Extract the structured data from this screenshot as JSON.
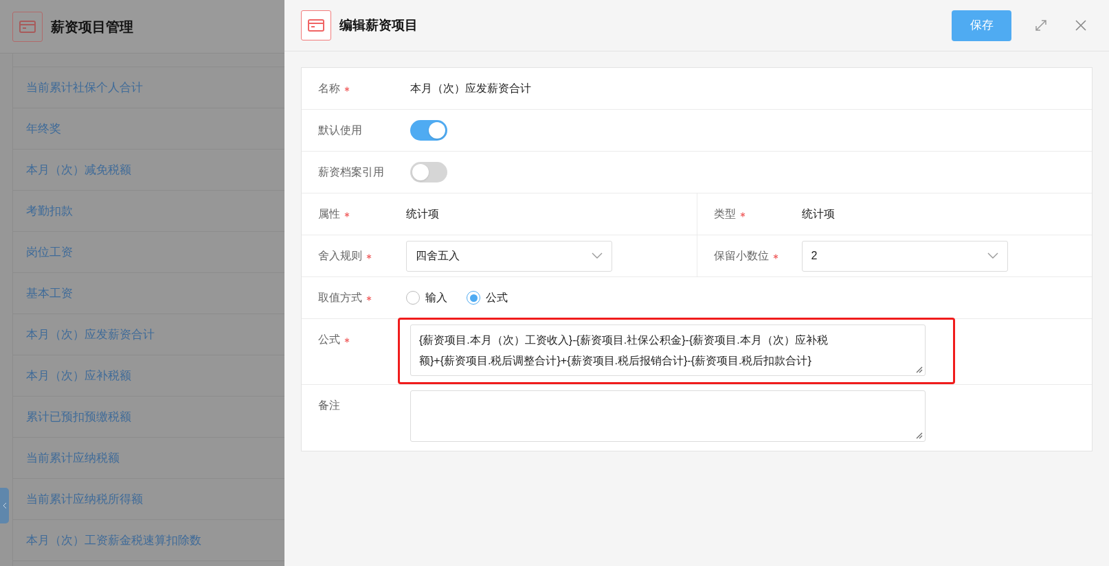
{
  "background_page": {
    "title": "薪资项目管理",
    "items": [
      "当前累计社保个人合计",
      "年终奖",
      "本月（次）减免税额",
      "考勤扣款",
      "岗位工资",
      "基本工资",
      "本月（次）应发薪资合计",
      "本月（次）应补税额",
      "累计已预扣预缴税额",
      "当前累计应纳税额",
      "当前累计应纳税所得额",
      "本月（次）工资薪金税速算扣除数"
    ]
  },
  "drawer": {
    "title": "编辑薪资项目",
    "save_button": "保存",
    "form": [
      {
        "kind": "text",
        "label": "名称",
        "required": true,
        "value": "本月（次）应发薪资合计"
      },
      {
        "kind": "switch",
        "label": "默认使用",
        "required": false,
        "on": true
      },
      {
        "kind": "switch",
        "label": "薪资档案引用",
        "required": false,
        "on": false
      },
      {
        "kind": "pair",
        "fields": [
          {
            "kind": "text",
            "label": "属性",
            "required": true,
            "value": "统计项"
          },
          {
            "kind": "text",
            "label": "类型",
            "required": true,
            "value": "统计项"
          }
        ]
      },
      {
        "kind": "pair",
        "fields": [
          {
            "kind": "select",
            "label": "舍入规则",
            "required": true,
            "value": "四舍五入"
          },
          {
            "kind": "select",
            "label": "保留小数位",
            "required": true,
            "value": "2"
          }
        ]
      },
      {
        "kind": "radio",
        "label": "取值方式",
        "required": true,
        "options": [
          {
            "label": "输入",
            "selected": false
          },
          {
            "label": "公式",
            "selected": true
          }
        ]
      },
      {
        "kind": "textarea",
        "label": "公式",
        "required": true,
        "value": "{薪资项目.本月（次）工资收入}-{薪资项目.社保公积金}-{薪资项目.本月（次）应补税额}+{薪资项目.税后调整合计}+{薪资项目.税后报销合计}-{薪资项目.税后扣款合计}",
        "highlighted": true
      },
      {
        "kind": "textarea",
        "label": "备注",
        "required": false,
        "highlighted": false
      }
    ]
  }
}
